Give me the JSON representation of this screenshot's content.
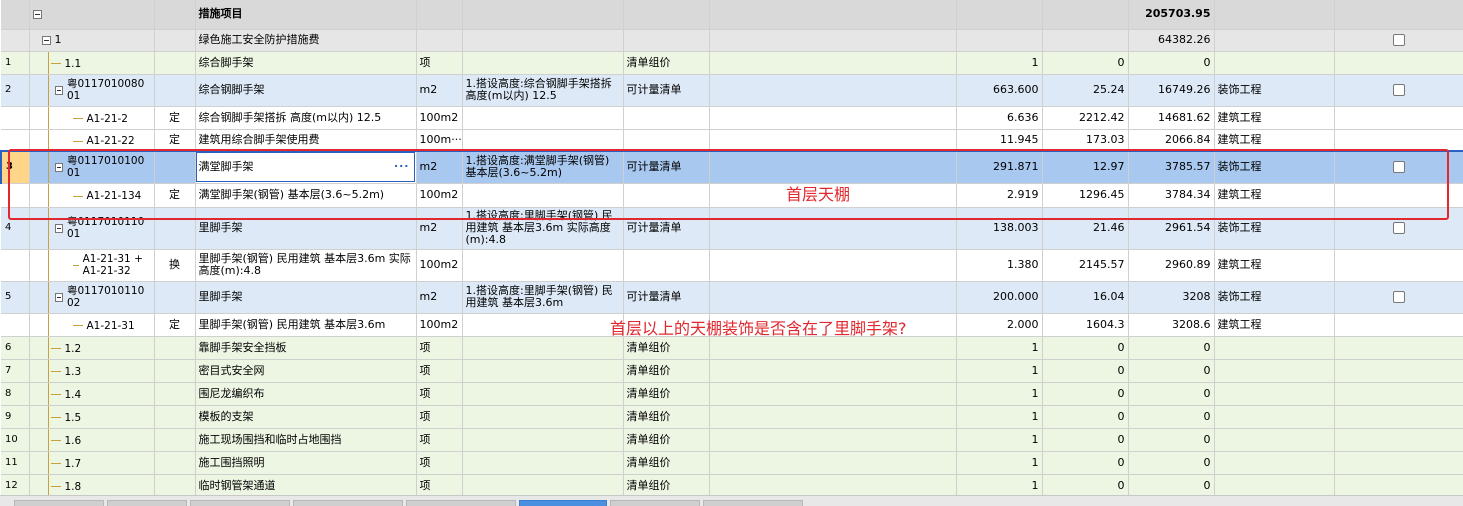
{
  "grid": {
    "header": {
      "checkbox_col": "",
      "name": "措施项目",
      "total": "205703.95"
    },
    "group": {
      "code": "1",
      "name": "绿色施工安全防护措施费",
      "total": "64382.26"
    },
    "rows": [
      {
        "rownum": "1",
        "type": "item",
        "code": "1.1",
        "mark": "",
        "name": "综合脚手架",
        "unit": "项",
        "feature": "",
        "calc": "清单组价",
        "qty": "1",
        "price": "0",
        "total": "0",
        "category": "",
        "checkbox": false
      },
      {
        "rownum": "2",
        "type": "qd",
        "code": "粤011701008001",
        "mark": "",
        "name": "综合钢脚手架",
        "unit": "m2",
        "feature": "1.搭设高度:综合钢脚手架搭拆 高度(m以内) 12.5",
        "calc": "可计量清单",
        "qty": "663.600",
        "price": "25.24",
        "total": "16749.26",
        "category": "装饰工程",
        "checkbox": true
      },
      {
        "rownum": "",
        "type": "de",
        "code": "A1-21-2",
        "mark": "定",
        "name": "综合钢脚手架搭拆 高度(m以内) 12.5",
        "unit": "100m2",
        "feature": "",
        "calc": "",
        "qty": "6.636",
        "price": "2212.42",
        "total": "14681.62",
        "category": "建筑工程",
        "checkbox": false
      },
      {
        "rownum": "",
        "type": "de",
        "code": "A1-21-22",
        "mark": "定",
        "name": "建筑用综合脚手架使用费",
        "unit": "100m···",
        "feature": "",
        "calc": "",
        "qty": "11.945",
        "price": "173.03",
        "total": "2066.84",
        "category": "建筑工程",
        "checkbox": false
      },
      {
        "rownum": "3",
        "type": "sel",
        "code": "粤011701010001",
        "mark": "",
        "name": "满堂脚手架",
        "unit": "m2",
        "feature": "1.搭设高度:满堂脚手架(钢管) 基本层(3.6~5.2m)",
        "calc": "可计量清单",
        "qty": "291.871",
        "price": "12.97",
        "total": "3785.57",
        "category": "装饰工程",
        "checkbox": true
      },
      {
        "rownum": "",
        "type": "de",
        "code": "A1-21-134",
        "mark": "定",
        "name": "满堂脚手架(钢管) 基本层(3.6~5.2m)",
        "unit": "100m2",
        "feature": "",
        "calc": "",
        "qty": "2.919",
        "price": "1296.45",
        "total": "3784.34",
        "category": "建筑工程",
        "checkbox": false
      },
      {
        "rownum": "4",
        "type": "qd",
        "code": "粤011701011001",
        "mark": "",
        "name": "里脚手架",
        "unit": "m2",
        "feature": "1.搭设高度:里脚手架(钢管) 民用建筑 基本层3.6m 实际高度(m):4.8",
        "calc": "可计量清单",
        "qty": "138.003",
        "price": "21.46",
        "total": "2961.54",
        "category": "装饰工程",
        "checkbox": true
      },
      {
        "rownum": "",
        "type": "de",
        "code": "A1-21-31 + A1-21-32",
        "mark": "换",
        "name": "里脚手架(钢管) 民用建筑 基本层3.6m 实际高度(m):4.8",
        "unit": "100m2",
        "feature": "",
        "calc": "",
        "qty": "1.380",
        "price": "2145.57",
        "total": "2960.89",
        "category": "建筑工程",
        "checkbox": false
      },
      {
        "rownum": "5",
        "type": "qd",
        "code": "粤011701011002",
        "mark": "",
        "name": "里脚手架",
        "unit": "m2",
        "feature": "1.搭设高度:里脚手架(钢管) 民用建筑 基本层3.6m",
        "calc": "可计量清单",
        "qty": "200.000",
        "price": "16.04",
        "total": "3208",
        "category": "装饰工程",
        "checkbox": true
      },
      {
        "rownum": "",
        "type": "de",
        "code": "A1-21-31",
        "mark": "定",
        "name": "里脚手架(钢管) 民用建筑 基本层3.6m",
        "unit": "100m2",
        "feature": "",
        "calc": "",
        "qty": "2.000",
        "price": "1604.3",
        "total": "3208.6",
        "category": "建筑工程",
        "checkbox": false
      },
      {
        "rownum": "6",
        "type": "item",
        "code": "1.2",
        "mark": "",
        "name": "靠脚手架安全挡板",
        "unit": "项",
        "feature": "",
        "calc": "清单组价",
        "qty": "1",
        "price": "0",
        "total": "0",
        "category": "",
        "checkbox": false
      },
      {
        "rownum": "7",
        "type": "item",
        "code": "1.3",
        "mark": "",
        "name": "密目式安全网",
        "unit": "项",
        "feature": "",
        "calc": "清单组价",
        "qty": "1",
        "price": "0",
        "total": "0",
        "category": "",
        "checkbox": false
      },
      {
        "rownum": "8",
        "type": "item",
        "code": "1.4",
        "mark": "",
        "name": "围尼龙编织布",
        "unit": "项",
        "feature": "",
        "calc": "清单组价",
        "qty": "1",
        "price": "0",
        "total": "0",
        "category": "",
        "checkbox": false
      },
      {
        "rownum": "9",
        "type": "item",
        "code": "1.5",
        "mark": "",
        "name": "模板的支架",
        "unit": "项",
        "feature": "",
        "calc": "清单组价",
        "qty": "1",
        "price": "0",
        "total": "0",
        "category": "",
        "checkbox": false
      },
      {
        "rownum": "10",
        "type": "item",
        "code": "1.6",
        "mark": "",
        "name": "施工现场围挡和临时占地围挡",
        "unit": "项",
        "feature": "",
        "calc": "清单组价",
        "qty": "1",
        "price": "0",
        "total": "0",
        "category": "",
        "checkbox": false
      },
      {
        "rownum": "11",
        "type": "item",
        "code": "1.7",
        "mark": "",
        "name": "施工围挡照明",
        "unit": "项",
        "feature": "",
        "calc": "清单组价",
        "qty": "1",
        "price": "0",
        "total": "0",
        "category": "",
        "checkbox": false
      },
      {
        "rownum": "12",
        "type": "item",
        "code": "1.8",
        "mark": "",
        "name": "临时钢管架通道",
        "unit": "项",
        "feature": "",
        "calc": "清单组价",
        "qty": "1",
        "price": "0",
        "total": "0",
        "category": "",
        "checkbox": false
      }
    ]
  },
  "annotations": {
    "first_floor": "首层天棚",
    "question": "首层以上的天棚装饰是否含在了里脚手架?"
  },
  "colors": {
    "annotation_red": "#e0282e",
    "selection_blue": "#a9c8ef",
    "item_green": "#edf5e3",
    "qd_blue": "#dde9f7"
  }
}
